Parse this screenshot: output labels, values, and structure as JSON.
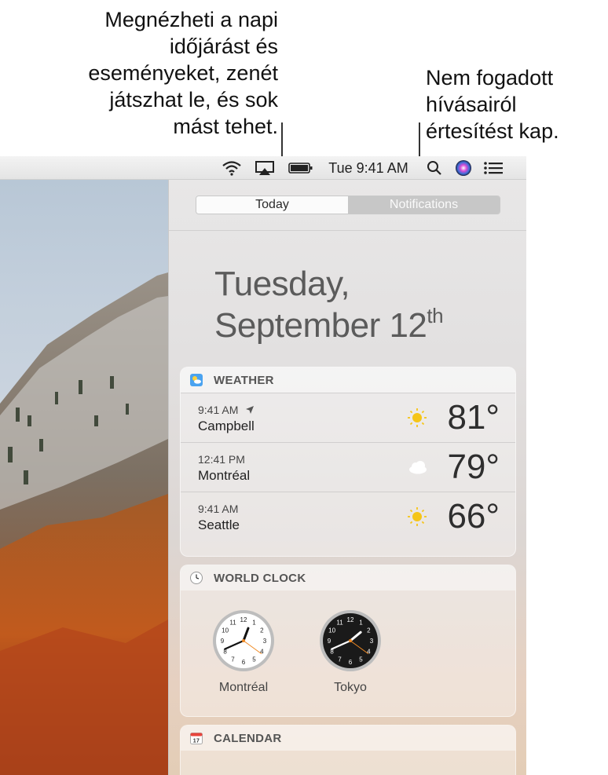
{
  "callouts": {
    "left_lines": [
      "Megnézheti a napi",
      "időjárást és",
      "eseményeket, zenét",
      "játszhat le, és sok",
      "mást tehet."
    ],
    "right_lines": [
      "Nem fogadott",
      "hívásairól",
      "értesítést kap."
    ]
  },
  "menubar": {
    "time": "Tue 9:41 AM",
    "icons": [
      "wifi-icon",
      "airplay-icon",
      "battery-icon",
      "spotlight-search-icon",
      "siri-icon",
      "notification-center-icon"
    ]
  },
  "panel": {
    "tabs": [
      {
        "label": "Today",
        "selected": true
      },
      {
        "label": "Notifications",
        "selected": false
      }
    ],
    "date": {
      "line1": "Tuesday,",
      "line2": "September 12",
      "suffix": "th"
    }
  },
  "weather": {
    "title": "WEATHER",
    "rows": [
      {
        "time": "9:41 AM",
        "city": "Campbell",
        "temp": "81°",
        "condition": "sunny",
        "location_arrow": true
      },
      {
        "time": "12:41 PM",
        "city": "Montréal",
        "temp": "79°",
        "condition": "cloudy",
        "location_arrow": false
      },
      {
        "time": "9:41 AM",
        "city": "Seattle",
        "temp": "66°",
        "condition": "sunny",
        "location_arrow": false
      }
    ]
  },
  "world_clock": {
    "title": "WORLD CLOCK",
    "clocks": [
      {
        "label": "Montréal",
        "theme": "light",
        "hour": 12,
        "minute": 41,
        "second": 21
      },
      {
        "label": "Tokyo",
        "theme": "dark",
        "hour": 1,
        "minute": 41,
        "second": 21
      }
    ]
  },
  "calendar": {
    "title": "CALENDAR"
  },
  "colors": {
    "accent_sun": "#f5c518",
    "seg_selected": "#fbfbfb",
    "seg_unselected": "#c7c7c7"
  }
}
